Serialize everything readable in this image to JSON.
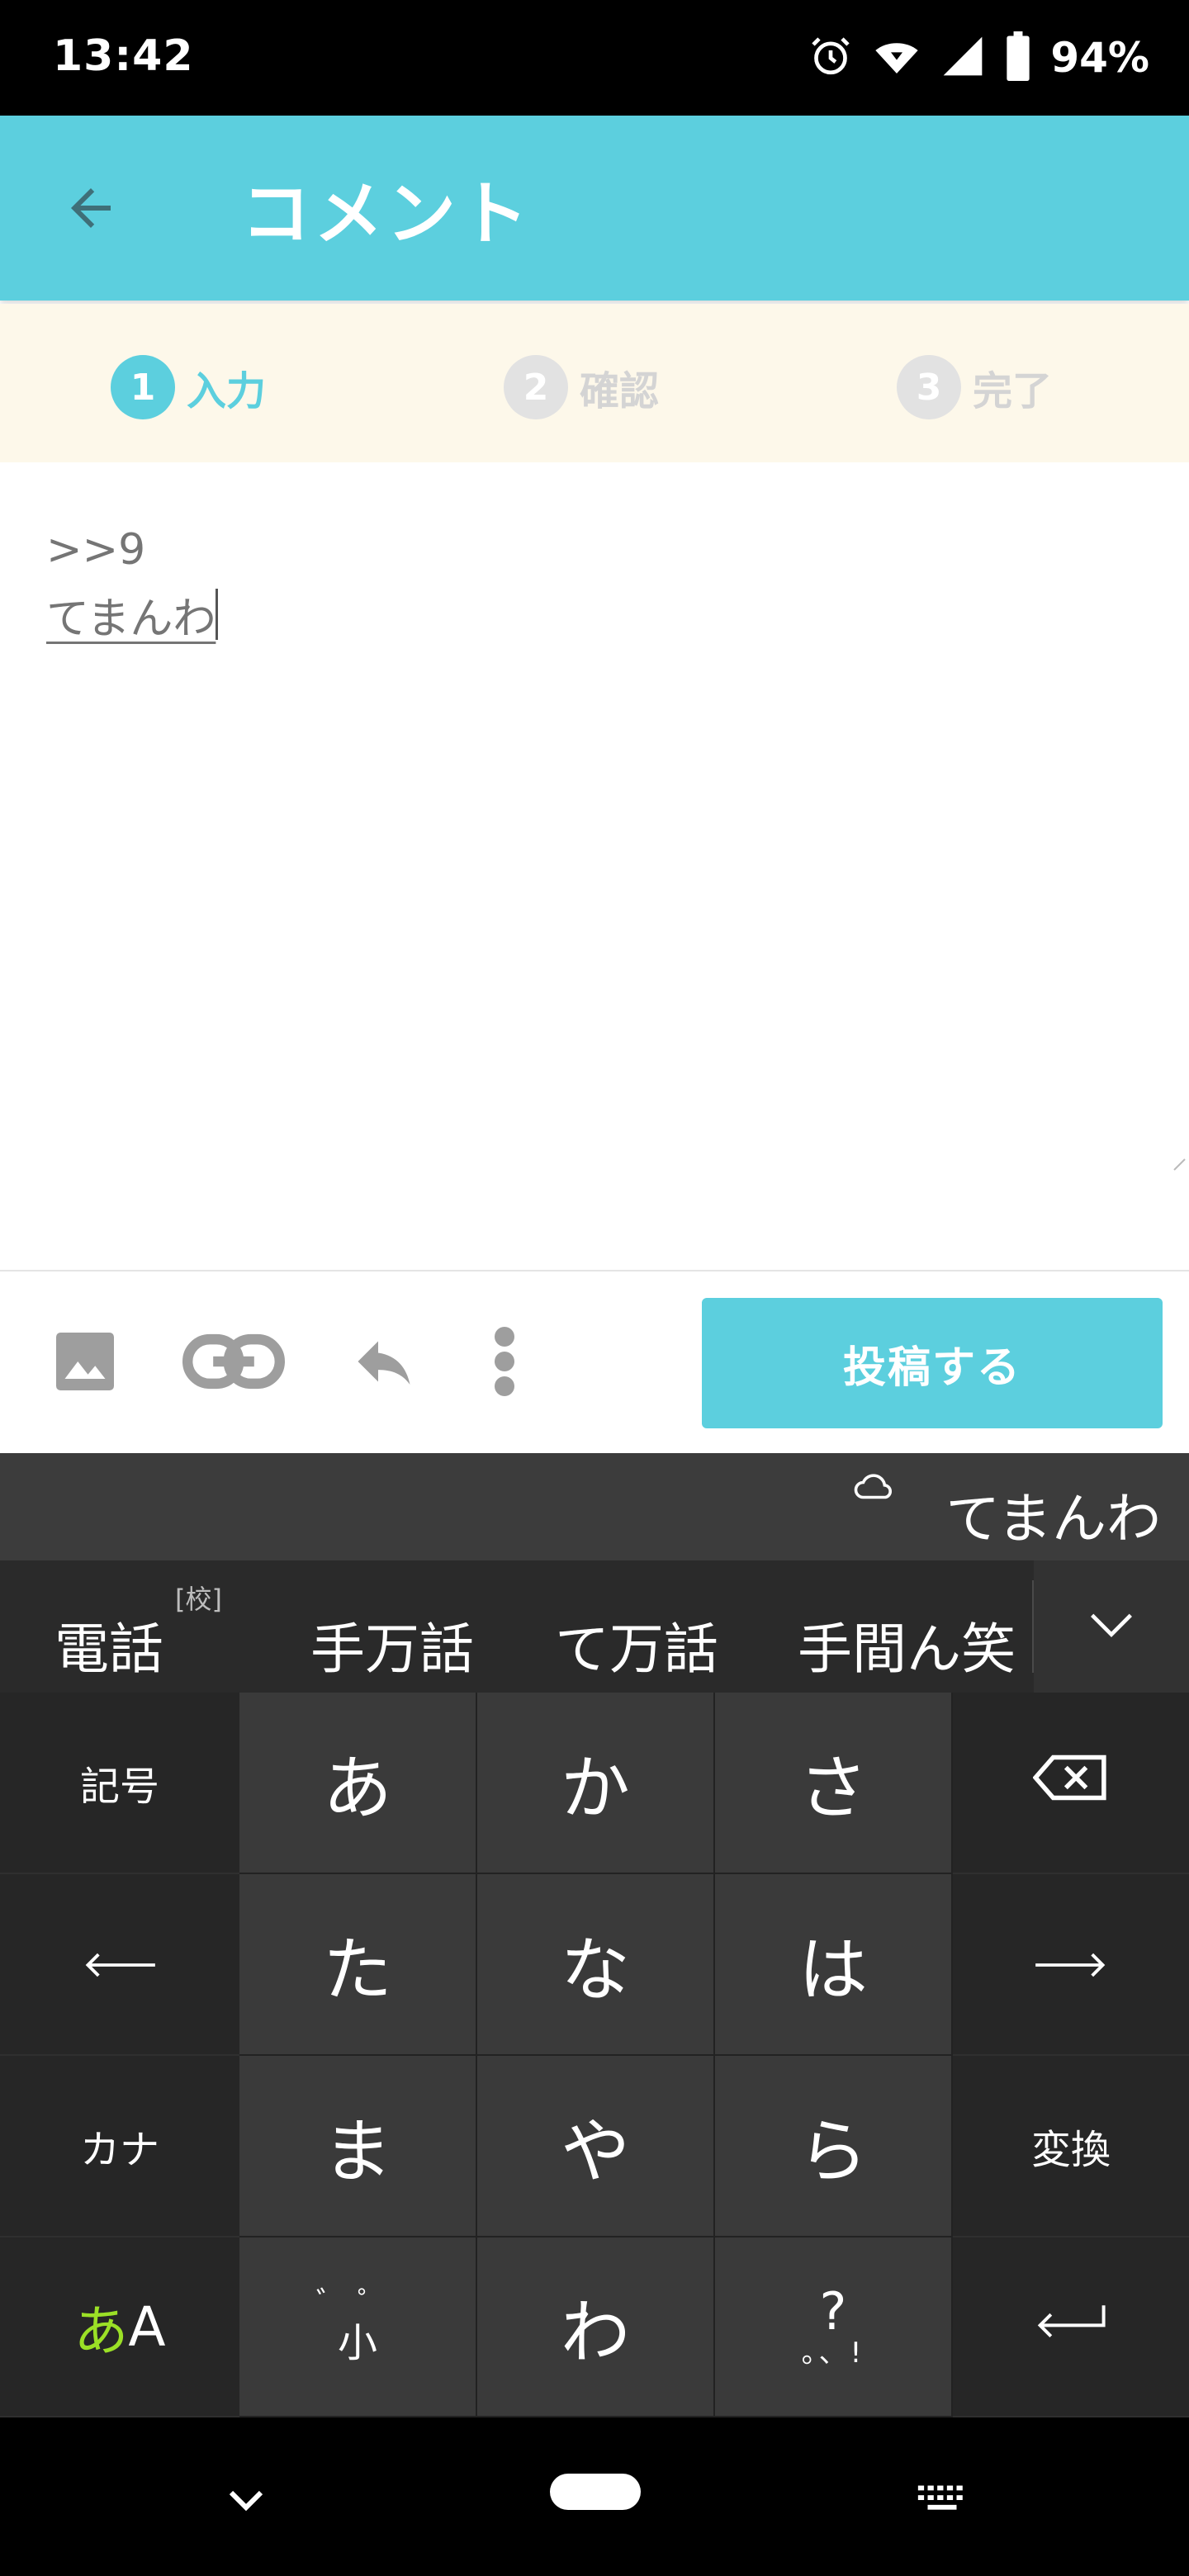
{
  "status_bar": {
    "time": "13:42",
    "battery": "94%",
    "icons": [
      "alarm-icon",
      "wifi-icon",
      "cell-signal-icon",
      "battery-icon"
    ]
  },
  "app_bar": {
    "title": "コメント",
    "back_icon": "arrow-left-icon",
    "color": "#5ccfde"
  },
  "stepper": {
    "steps": [
      {
        "number": "1",
        "label": "入力",
        "state": "active"
      },
      {
        "number": "2",
        "label": "確認",
        "state": "inactive"
      },
      {
        "number": "3",
        "label": "完了",
        "state": "inactive"
      }
    ]
  },
  "comment": {
    "reply_ref": ">>9",
    "composing_text": "てまんわ"
  },
  "toolbar": {
    "icons": [
      "image-icon",
      "link-icon",
      "reply-icon",
      "more-vert-icon"
    ],
    "submit_label": "投稿する"
  },
  "keyboard": {
    "composition_text": "てまんわ",
    "candidates": [
      "電話",
      "手万話",
      "て万話",
      "手間ん笑"
    ],
    "candidate_badge": "[校]",
    "keys": {
      "symbols": "記号",
      "a": "あ",
      "ka": "か",
      "sa": "さ",
      "ta": "た",
      "na": "な",
      "ha": "は",
      "ma": "ま",
      "ya": "や",
      "ra": "ら",
      "kana": "カナ",
      "convert": "変換",
      "mode_a": "あ",
      "mode_A": "A",
      "dakuten_top": "゛゜",
      "dakuten_bottom": "小",
      "wa": "わ",
      "punct_top": "?",
      "punct_bottom": "。、!"
    }
  },
  "nav_bar": {
    "icons": [
      "chevron-down-icon",
      "home-pill-icon",
      "keyboard-icon"
    ]
  }
}
